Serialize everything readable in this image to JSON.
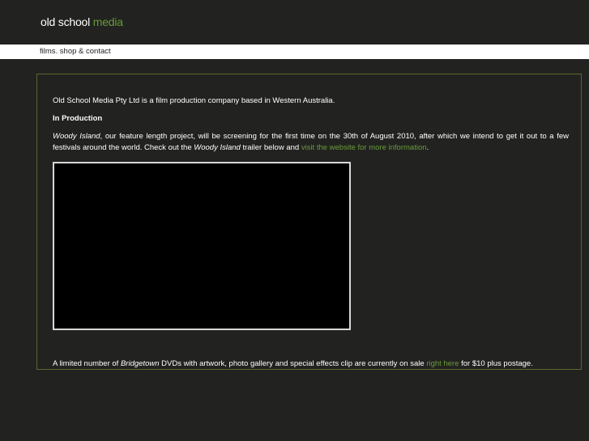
{
  "header": {
    "logo_part1": "old school",
    "logo_part2": "media"
  },
  "nav": {
    "links_text": "films. shop & contact"
  },
  "content": {
    "intro": "Old School Media Pty Ltd is a film production company based in Western Australia.",
    "section_heading": "In Production",
    "para2_title": "Woody Island",
    "para2_text1": ", our feature length project, will be screening for the first time on the 30th of August 2010, after which we intend to get it out to a few festivals around the world. Check out the ",
    "para2_title2": "Woody Island",
    "para2_text2": " trailer below and ",
    "para2_link": "visit the website for more information",
    "para2_end": ".",
    "para3_text1": "A limited number of ",
    "para3_title": "Bridgetown",
    "para3_text2": " DVDs with artwork, photo gallery and special effects clip are currently on sale ",
    "para3_link": "right here",
    "para3_text3": " for $10 plus postage."
  },
  "colors": {
    "background": "#222320",
    "accent_green": "#6a9a3c",
    "box_border": "#58672f"
  }
}
